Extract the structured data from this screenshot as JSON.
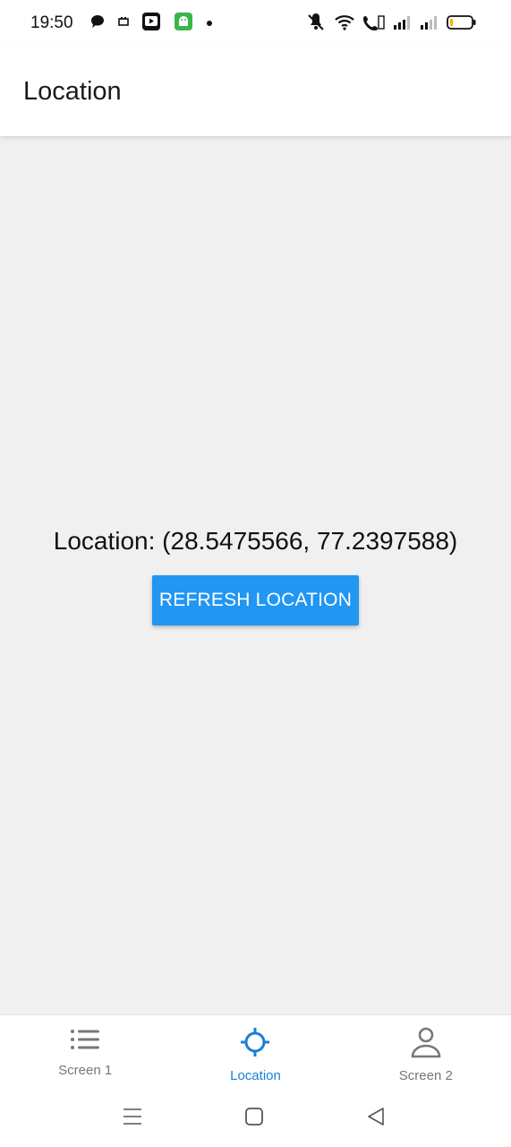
{
  "status_bar": {
    "time": "19:50",
    "left_icons": [
      "chat-bubble-icon",
      "notification-icon",
      "youtube-icon",
      "android-icon",
      "dot-icon"
    ],
    "right_icons": [
      "mute-icon",
      "wifi-icon",
      "volte-icon",
      "signal-icon",
      "signal-icon",
      "battery-icon"
    ],
    "battery_level": 0.15,
    "battery_color": "#f5b400"
  },
  "app_bar": {
    "title": "Location"
  },
  "main": {
    "location_text": "Location: (28.5475566, 77.2397588)",
    "refresh_button_label": "REFRESH LOCATION",
    "button_color": "#2196f3"
  },
  "bottom_nav": {
    "items": [
      {
        "label": "Screen 1",
        "icon": "list-icon",
        "active": false
      },
      {
        "label": "Location",
        "icon": "crosshair-icon",
        "active": true
      },
      {
        "label": "Screen 2",
        "icon": "person-icon",
        "active": false
      }
    ],
    "active_color": "#1a7fd6",
    "inactive_color": "#777777"
  },
  "system_nav": {
    "buttons": [
      "menu-icon",
      "home-icon",
      "back-icon"
    ]
  }
}
